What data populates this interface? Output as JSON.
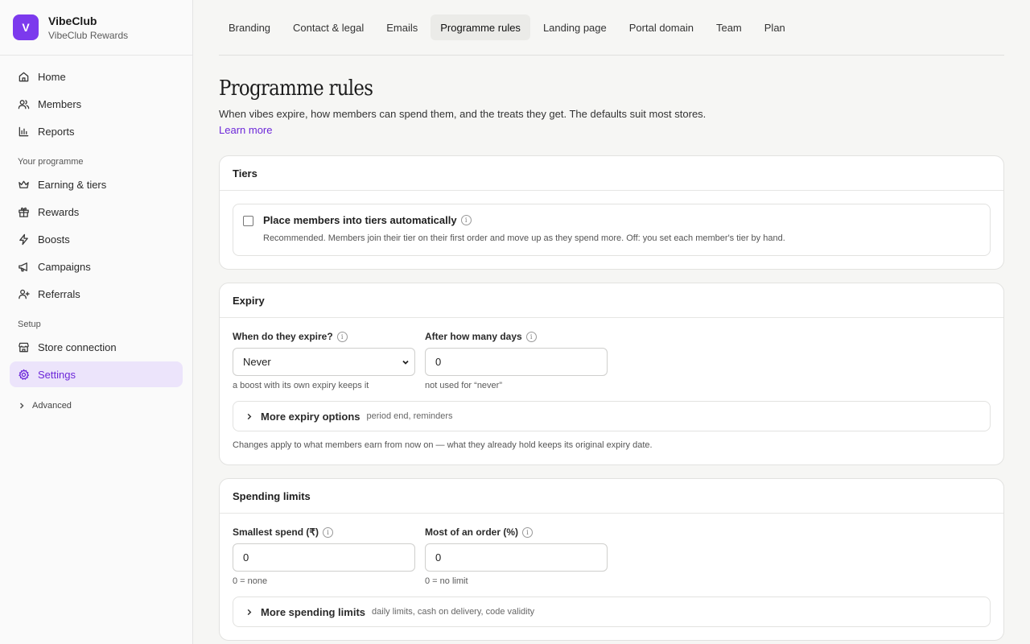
{
  "brand": {
    "logo_letter": "V",
    "name": "VibeClub",
    "subtitle": "VibeClub Rewards"
  },
  "sidebar": {
    "items": [
      {
        "label": "Home",
        "icon": "home-icon"
      },
      {
        "label": "Members",
        "icon": "users-icon"
      },
      {
        "label": "Reports",
        "icon": "bar-chart-icon"
      }
    ],
    "section_programme": "Your programme",
    "programme_items": [
      {
        "label": "Earning & tiers",
        "icon": "crown-icon"
      },
      {
        "label": "Rewards",
        "icon": "gift-icon"
      },
      {
        "label": "Boosts",
        "icon": "bolt-icon"
      },
      {
        "label": "Campaigns",
        "icon": "megaphone-icon"
      },
      {
        "label": "Referrals",
        "icon": "user-plus-icon"
      }
    ],
    "section_setup": "Setup",
    "setup_items": [
      {
        "label": "Store connection",
        "icon": "store-icon"
      },
      {
        "label": "Settings",
        "icon": "gear-icon",
        "active": true
      }
    ],
    "advanced": "Advanced"
  },
  "tabs": [
    "Branding",
    "Contact & legal",
    "Emails",
    "Programme rules",
    "Landing page",
    "Portal domain",
    "Team",
    "Plan"
  ],
  "active_tab": "Programme rules",
  "page": {
    "title": "Programme rules",
    "description": "When vibes expire, how members can spend them, and the treats they get. The defaults suit most stores.",
    "learn_more": "Learn more"
  },
  "tiers": {
    "heading": "Tiers",
    "auto_label": "Place members into tiers automatically",
    "auto_checked": false,
    "auto_desc": "Recommended. Members join their tier on their first order and move up as they spend more. Off: you set each member's tier by hand."
  },
  "expiry": {
    "heading": "Expiry",
    "when_label": "When do they expire?",
    "when_value": "Never",
    "when_hint": "a boost with its own expiry keeps it",
    "days_label": "After how many days",
    "days_value": "0",
    "days_hint": "not used for “never”",
    "more_title": "More expiry options",
    "more_sub": "period end, reminders",
    "note": "Changes apply to what members earn from now on — what they already hold keeps its original expiry date."
  },
  "spending": {
    "heading": "Spending limits",
    "min_label": "Smallest spend (₹)",
    "min_value": "0",
    "min_hint": "0 = none",
    "max_label": "Most of an order (%)",
    "max_value": "0",
    "max_hint": "0 = no limit",
    "more_title": "More spending limits",
    "more_sub": "daily limits, cash on delivery, code validity"
  },
  "colors": {
    "accent": "#7c3aed",
    "active_bg": "#ece4fb"
  }
}
